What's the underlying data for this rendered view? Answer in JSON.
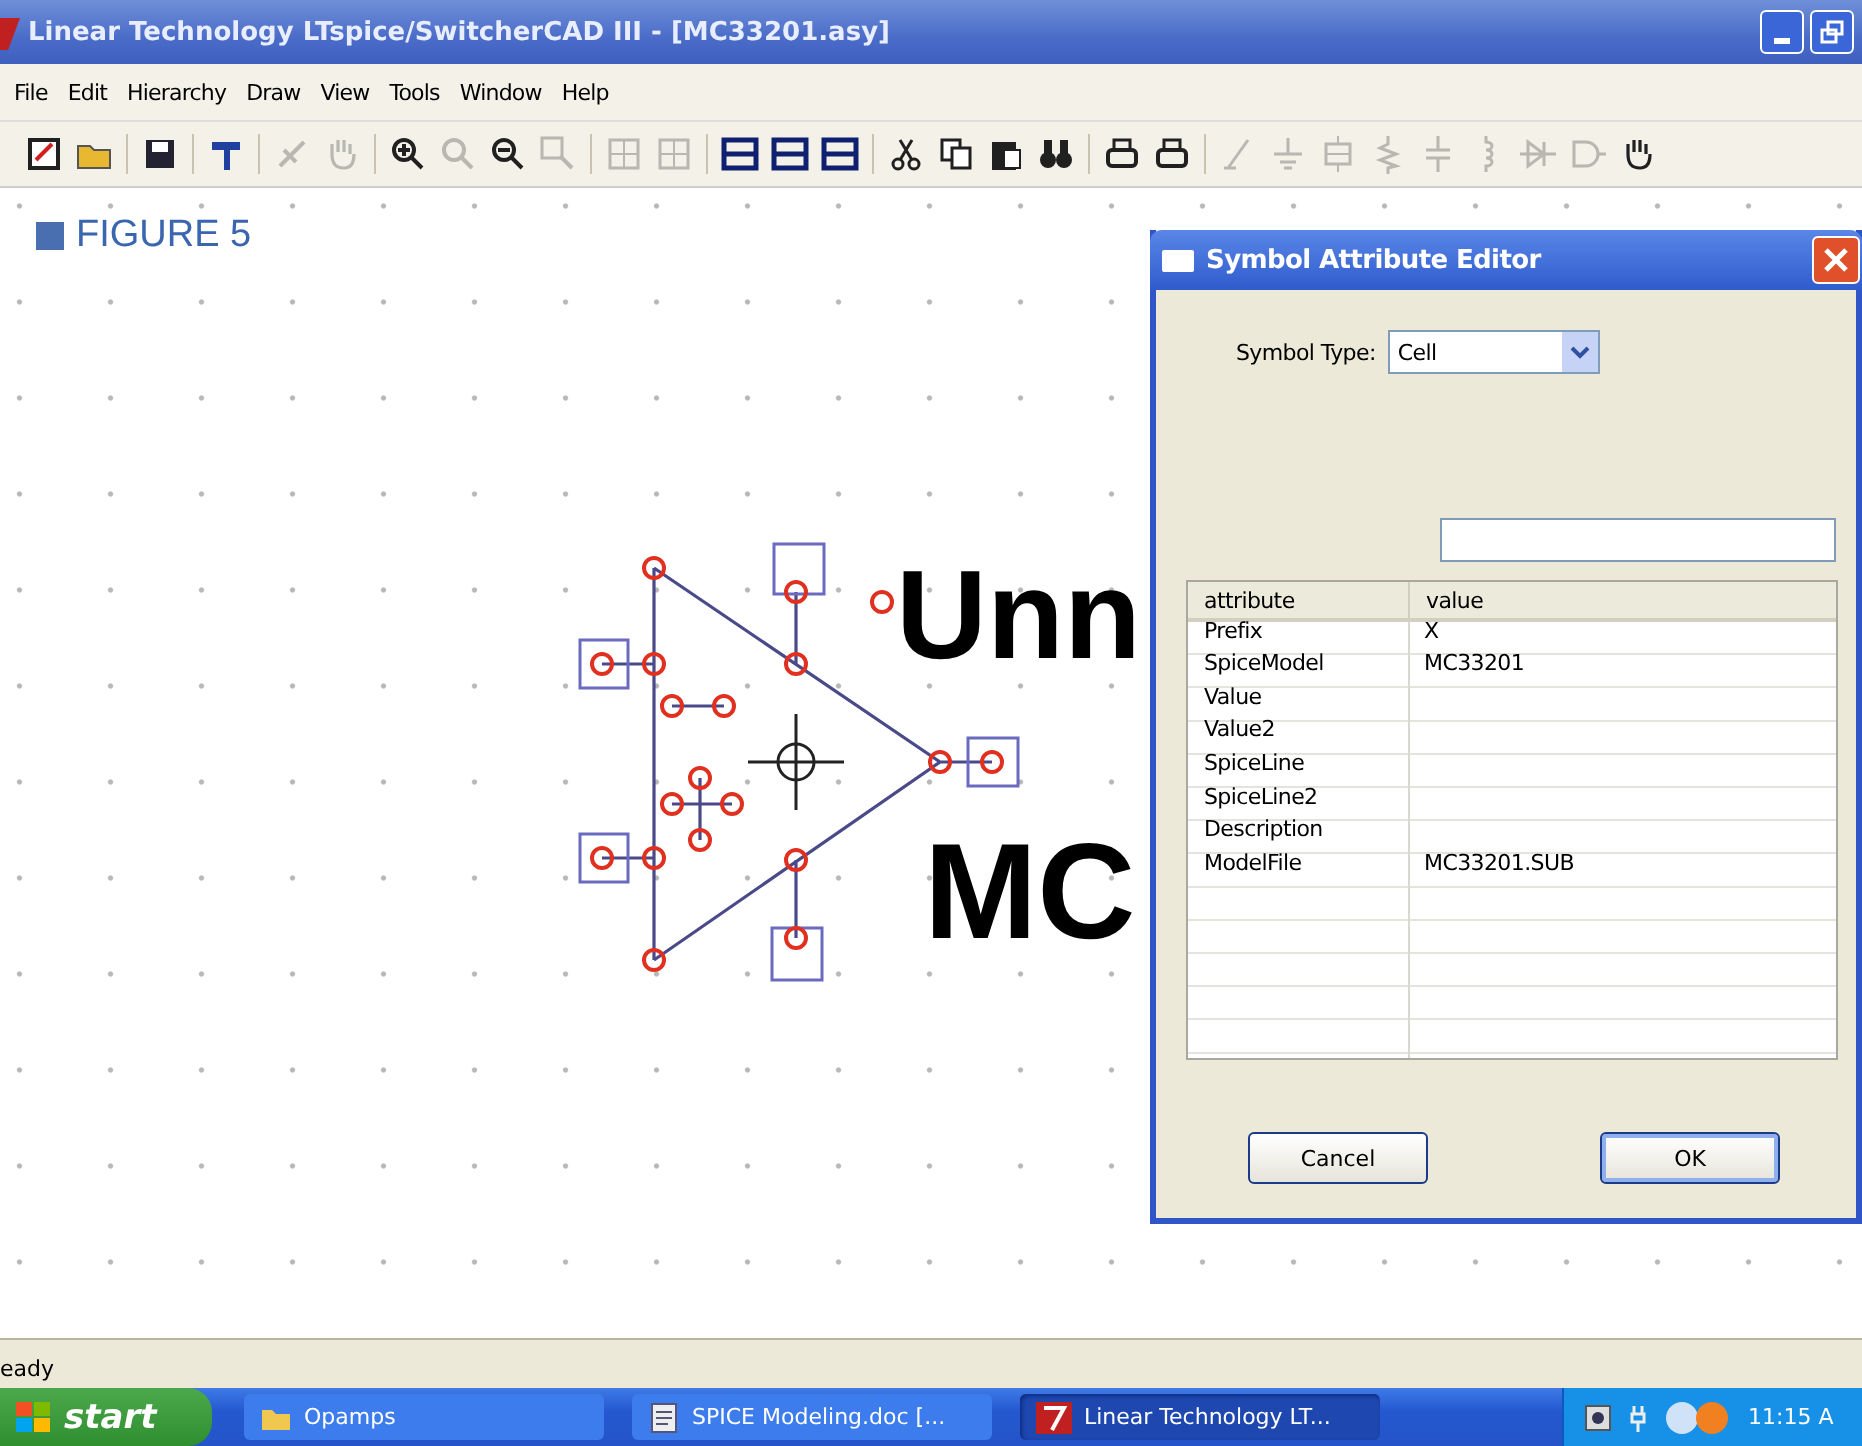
{
  "window": {
    "title": "Linear Technology LTspice/SwitcherCAD III - [MC33201.asy]"
  },
  "menu": [
    "File",
    "Edit",
    "Hierarchy",
    "Draw",
    "View",
    "Tools",
    "Window",
    "Help"
  ],
  "toolbar": [
    [
      {
        "disabled": false
      },
      {
        "disabled": false
      }
    ],
    [
      {
        "disabled": false
      }
    ],
    [
      {
        "disabled": false
      }
    ],
    [
      {
        "disabled": true
      },
      {
        "disabled": true
      }
    ],
    [
      {
        "disabled": false
      },
      {
        "disabled": true
      },
      {
        "disabled": false
      },
      {
        "disabled": true
      }
    ],
    [
      {
        "disabled": true
      },
      {
        "disabled": true
      }
    ],
    [
      {
        "disabled": false
      },
      {
        "disabled": false
      },
      {
        "disabled": false
      }
    ],
    [
      {
        "disabled": false
      },
      {
        "disabled": false
      },
      {
        "disabled": false
      },
      {
        "disabled": false
      }
    ],
    [
      {
        "disabled": false
      },
      {
        "disabled": false
      }
    ],
    [
      {
        "disabled": true
      },
      {
        "disabled": true
      },
      {
        "disabled": true
      },
      {
        "disabled": true
      },
      {
        "disabled": true
      },
      {
        "disabled": true
      },
      {
        "disabled": true
      },
      {
        "disabled": true
      },
      {
        "disabled": false
      }
    ]
  ],
  "figure_label": "FIGURE 5",
  "symbol_texts": [
    "Unn",
    "MC"
  ],
  "dialog": {
    "title": "Symbol Attribute Editor",
    "symbol_type_label": "Symbol Type:",
    "symbol_type": "Cell",
    "columns": [
      "attribute",
      "value"
    ],
    "rows": [
      {
        "attribute": "Prefix",
        "value": "X"
      },
      {
        "attribute": "SpiceModel",
        "value": "MC33201"
      },
      {
        "attribute": "Value"
      },
      {
        "attribute": "Value2"
      },
      {
        "attribute": "SpiceLine"
      },
      {
        "attribute": "SpiceLine2"
      },
      {
        "attribute": "Description"
      },
      {
        "attribute": "ModelFile",
        "value": "MC33201.SUB"
      }
    ],
    "buttons": [
      "Cancel",
      "OK"
    ]
  },
  "status_bar": "eady",
  "taskbar": {
    "start": "start",
    "items": [
      {
        "label": "Opamps",
        "selected": false
      },
      {
        "label": "SPICE Modeling.doc [...",
        "selected": false
      },
      {
        "label": "Linear Technology LT...",
        "selected": true
      }
    ],
    "clock": "11:15 A"
  }
}
